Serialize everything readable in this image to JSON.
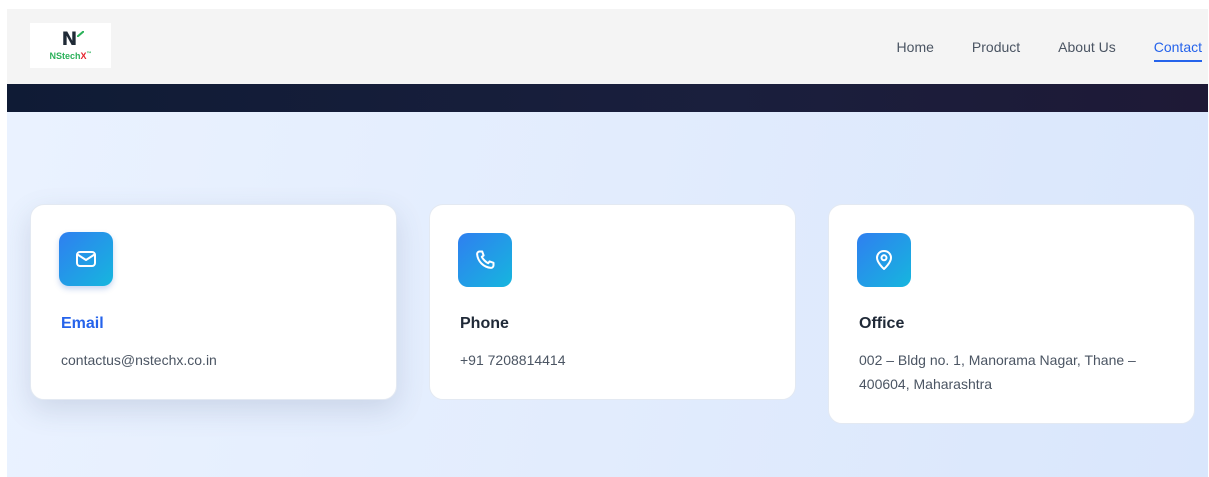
{
  "brand": {
    "logo_text": "NStech",
    "logo_x": "X",
    "logo_tm": "™"
  },
  "nav": {
    "items": [
      {
        "label": "Home"
      },
      {
        "label": "Product"
      },
      {
        "label": "About Us"
      },
      {
        "label": "Contact",
        "active": true
      }
    ]
  },
  "contact_cards": [
    {
      "icon": "mail-icon",
      "title": "Email",
      "text": "contactus@nstechx.co.in"
    },
    {
      "icon": "phone-icon",
      "title": "Phone",
      "text": "+91 7208814414"
    },
    {
      "icon": "map-pin-icon",
      "title": "Office",
      "text": "002 – Bldg no. 1, Manorama Nagar, Thane – 400604, Maharashtra"
    }
  ],
  "colors": {
    "accent": "#2563eb",
    "icon_gradient_start": "#2f7ff0",
    "icon_gradient_end": "#16b6de",
    "dark_band": "#0f1b35",
    "logo_green": "#2bb15a",
    "logo_red": "#e4232b"
  }
}
